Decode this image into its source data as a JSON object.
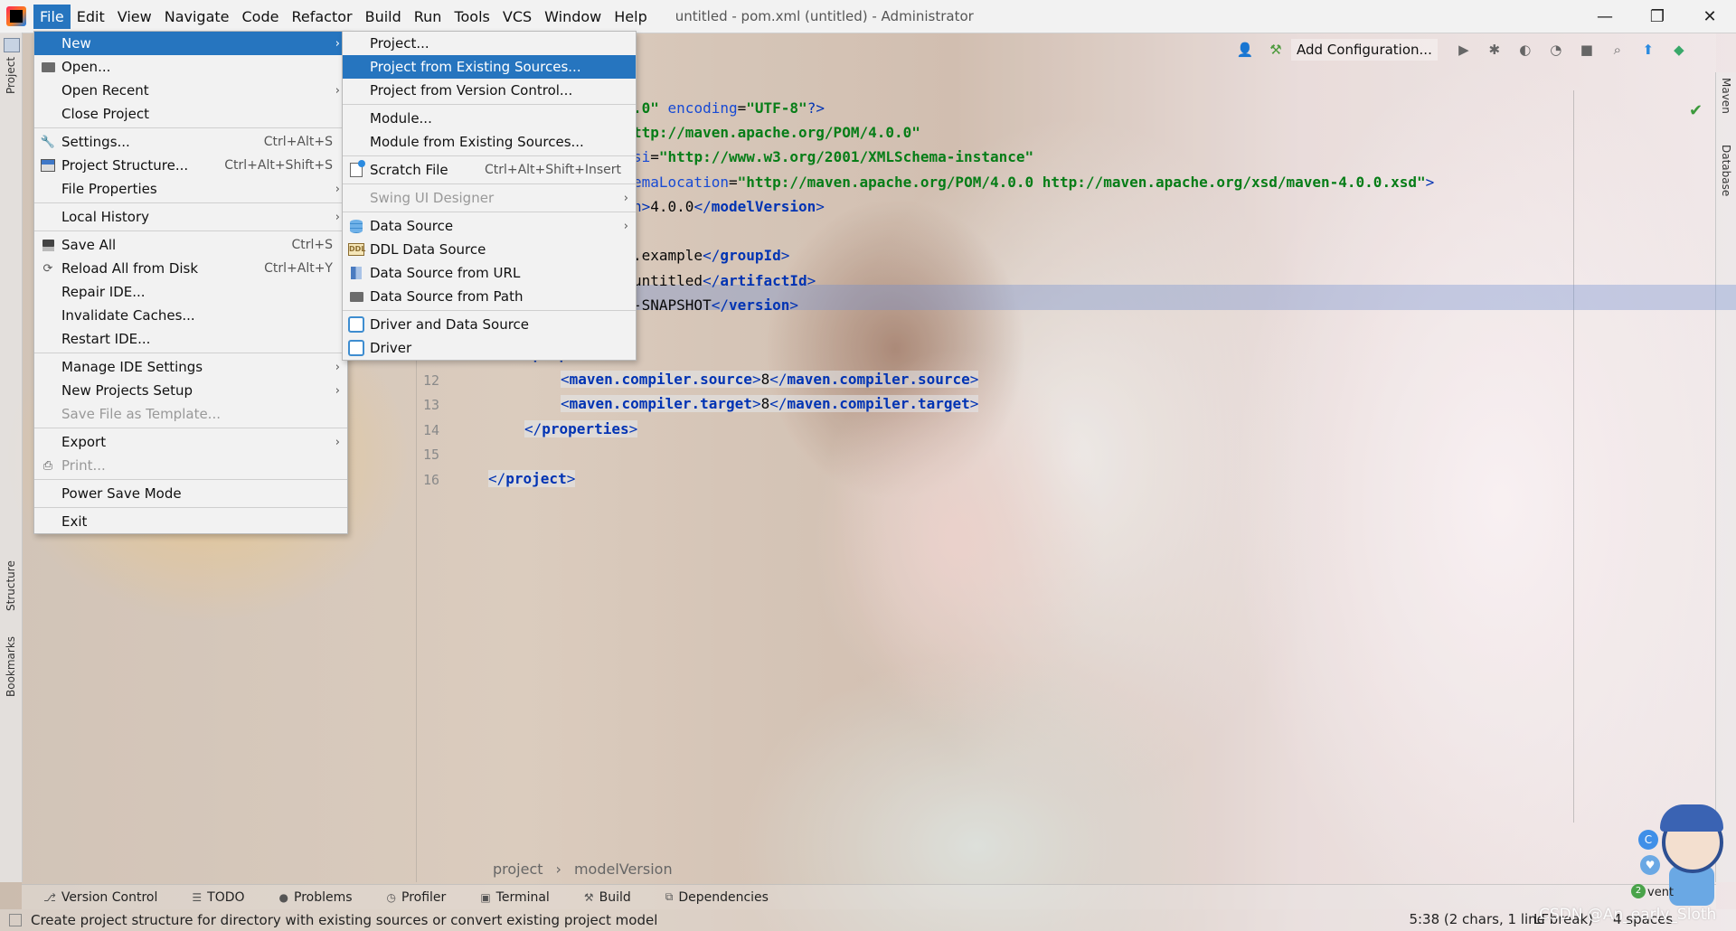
{
  "window": {
    "title": "untitled - pom.xml (untitled) - Administrator",
    "controls": {
      "minimize": "—",
      "restore": "❐",
      "close": "✕"
    }
  },
  "menubar": [
    "File",
    "Edit",
    "View",
    "Navigate",
    "Code",
    "Refactor",
    "Build",
    "Run",
    "Tools",
    "VCS",
    "Window",
    "Help"
  ],
  "toolbar": {
    "add_configuration": "Add Configuration..."
  },
  "file_menu": [
    {
      "label": "New",
      "shortcut": "",
      "submenu": true,
      "selected": true,
      "icon": ""
    },
    {
      "label": "Open...",
      "shortcut": "",
      "icon": "folder-icon"
    },
    {
      "label": "Open Recent",
      "shortcut": "",
      "submenu": true,
      "icon": ""
    },
    {
      "label": "Close Project",
      "shortcut": "",
      "icon": ""
    },
    {
      "sep": true
    },
    {
      "label": "Settings...",
      "shortcut": "Ctrl+Alt+S",
      "icon": "wrench-icon"
    },
    {
      "label": "Project Structure...",
      "shortcut": "Ctrl+Alt+Shift+S",
      "icon": "project-structure-icon"
    },
    {
      "label": "File Properties",
      "shortcut": "",
      "submenu": true,
      "icon": ""
    },
    {
      "sep": true
    },
    {
      "label": "Local History",
      "shortcut": "",
      "submenu": true,
      "icon": ""
    },
    {
      "sep": true
    },
    {
      "label": "Save All",
      "shortcut": "Ctrl+S",
      "icon": "save-icon"
    },
    {
      "label": "Reload All from Disk",
      "shortcut": "Ctrl+Alt+Y",
      "icon": "reload-icon"
    },
    {
      "label": "Repair IDE...",
      "shortcut": "",
      "icon": ""
    },
    {
      "label": "Invalidate Caches...",
      "shortcut": "",
      "icon": ""
    },
    {
      "label": "Restart IDE...",
      "shortcut": "",
      "icon": ""
    },
    {
      "sep": true
    },
    {
      "label": "Manage IDE Settings",
      "shortcut": "",
      "submenu": true,
      "icon": ""
    },
    {
      "label": "New Projects Setup",
      "shortcut": "",
      "submenu": true,
      "icon": ""
    },
    {
      "label": "Save File as Template...",
      "shortcut": "",
      "disabled": true,
      "icon": ""
    },
    {
      "sep": true
    },
    {
      "label": "Export",
      "shortcut": "",
      "submenu": true,
      "icon": ""
    },
    {
      "label": "Print...",
      "shortcut": "",
      "disabled": true,
      "icon": "print-icon"
    },
    {
      "sep": true
    },
    {
      "label": "Power Save Mode",
      "shortcut": "",
      "icon": ""
    },
    {
      "sep": true
    },
    {
      "label": "Exit",
      "shortcut": "",
      "icon": ""
    }
  ],
  "new_submenu": [
    {
      "label": "Project...",
      "shortcut": "",
      "icon": ""
    },
    {
      "label": "Project from Existing Sources...",
      "shortcut": "",
      "selected": true,
      "icon": ""
    },
    {
      "label": "Project from Version Control...",
      "shortcut": "",
      "icon": ""
    },
    {
      "sep": true
    },
    {
      "label": "Module...",
      "shortcut": "",
      "icon": ""
    },
    {
      "label": "Module from Existing Sources...",
      "shortcut": "",
      "icon": ""
    },
    {
      "sep": true
    },
    {
      "label": "Scratch File",
      "shortcut": "Ctrl+Alt+Shift+Insert",
      "icon": "scratch-file-icon"
    },
    {
      "sep": true
    },
    {
      "label": "Swing UI Designer",
      "shortcut": "",
      "submenu": true,
      "disabled": true,
      "icon": ""
    },
    {
      "sep": true
    },
    {
      "label": "Data Source",
      "shortcut": "",
      "submenu": true,
      "icon": "database-icon"
    },
    {
      "label": "DDL Data Source",
      "shortcut": "",
      "icon": "ddl-icon"
    },
    {
      "label": "Data Source from URL",
      "shortcut": "",
      "icon": "url-icon"
    },
    {
      "label": "Data Source from Path",
      "shortcut": "",
      "icon": "folder-icon"
    },
    {
      "sep": true
    },
    {
      "label": "Driver and Data Source",
      "shortcut": "",
      "icon": "driver-icon"
    },
    {
      "label": "Driver",
      "shortcut": "",
      "icon": "driver-icon"
    }
  ],
  "editor": {
    "line_numbers": [
      "12",
      "13",
      "14",
      "15",
      "16"
    ],
    "fragments": {
      "l1a": ".0\"",
      "l1b": " encoding",
      "l1c": "=",
      "l1d": "\"UTF-8\"",
      "l1e": "?>",
      "l2a": "ttp://maven.apache.org/POM/4.0.0\"",
      "l3a": "si",
      "l3b": "=",
      "l3c": "\"http://www.w3.org/2001/XMLSchema-instance\"",
      "l4a": "emaLocation",
      "l4b": "=",
      "l4c": "\"http://maven.apache.org/POM/4.0.0 http://maven.apache.org/xsd/maven-4.0.0.xsd\"",
      "l4d": ">",
      "l5a": "n>",
      "l5b": "4.0.0",
      "l5c": "</",
      "l5d": "modelVersion",
      "l5e": ">",
      "l7a": ".example",
      "l7b": "</",
      "l7c": "groupId",
      "l7d": ">",
      "l8a": "untitled",
      "l8b": "</",
      "l8c": "artifactId",
      "l8d": ">",
      "l9a": "-SNAPSHOT",
      "l9b": "</",
      "l9c": "version",
      "l9d": ">",
      "l11a": "<",
      "l11b": "properties",
      "l11c": ">",
      "l12a": "<",
      "l12b": "maven.compiler.source",
      "l12c": ">",
      "l12d": "8",
      "l12e": "</",
      "l12f": "maven.compiler.source",
      "l12g": ">",
      "l13a": "<",
      "l13b": "maven.compiler.target",
      "l13c": ">",
      "l13d": "8",
      "l13e": "</",
      "l13f": "maven.compiler.target",
      "l13g": ">",
      "l14a": "</",
      "l14b": "properties",
      "l14c": ">",
      "l16a": "</",
      "l16b": "project",
      "l16c": ">"
    }
  },
  "breadcrumb": [
    "project",
    "modelVersion"
  ],
  "left_tabs": [
    "Project",
    "Structure",
    "Bookmarks"
  ],
  "right_tabs": [
    "Maven",
    "Database"
  ],
  "tool_windows": [
    {
      "label": "Version Control",
      "icon": "version-control-icon"
    },
    {
      "label": "TODO",
      "icon": "todo-icon"
    },
    {
      "label": "Problems",
      "icon": "problems-icon"
    },
    {
      "label": "Profiler",
      "icon": "profiler-icon"
    },
    {
      "label": "Terminal",
      "icon": "terminal-icon"
    },
    {
      "label": "Build",
      "icon": "build-icon"
    },
    {
      "label": "Dependencies",
      "icon": "dependencies-icon"
    }
  ],
  "status": {
    "message": "Create project structure for directory with existing sources or convert existing project model",
    "position": "5:38 (2 chars, 1 line break)",
    "line_sep": "LF",
    "indent": "4 spaces",
    "event_log_count": "2",
    "event_log_label": "vent"
  },
  "watermark": "CSDN @An_early_Sloth",
  "colors": {
    "selection": "#2675bf",
    "menu_bg": "#f2f2f2",
    "xml_tag": "#0033b3",
    "xml_string": "#067d17"
  }
}
